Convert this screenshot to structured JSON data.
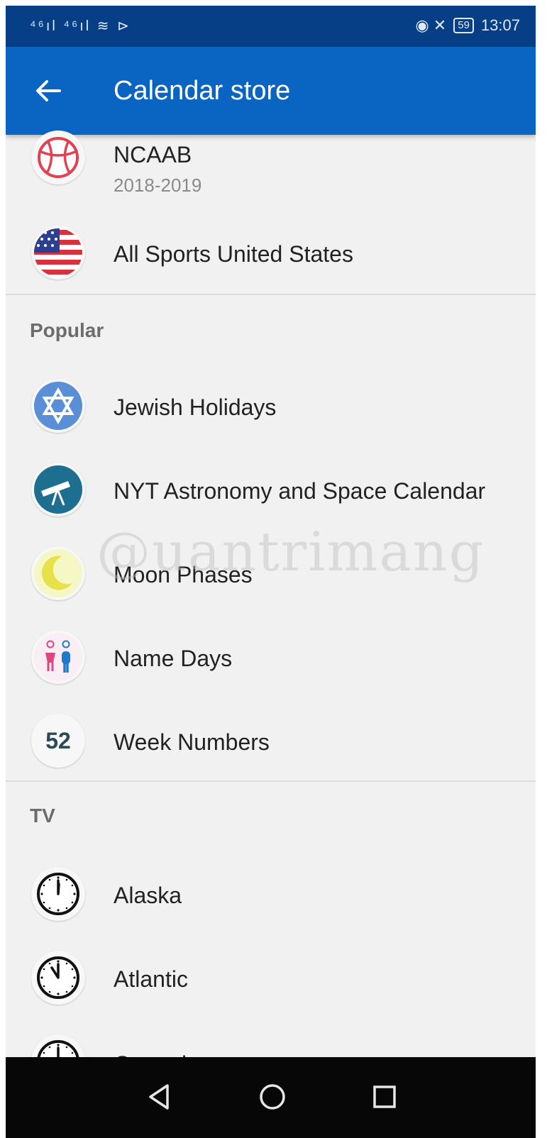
{
  "status_bar": {
    "signal_icons": "⁴⁶ıl ⁴⁶ıl ≋ ⊳",
    "right_icons": "◉ ✕",
    "battery": "59",
    "time": "13:07"
  },
  "app_bar": {
    "title": "Calendar store"
  },
  "top_items": [
    {
      "title": "NCAAB",
      "subtitle": "2018-2019",
      "icon": "basketball-icon"
    },
    {
      "title": "All Sports United States",
      "icon": "us-flag-icon"
    }
  ],
  "sections": [
    {
      "header": "Popular",
      "items": [
        {
          "title": "Jewish Holidays",
          "icon": "star-of-david-icon"
        },
        {
          "title": "NYT Astronomy and Space Calendar",
          "icon": "telescope-icon"
        },
        {
          "title": "Moon Phases",
          "icon": "crescent-moon-icon"
        },
        {
          "title": "Name Days",
          "icon": "people-icon"
        },
        {
          "title": "Week Numbers",
          "icon": "week-number-icon",
          "icon_text": "52"
        }
      ]
    },
    {
      "header": "TV",
      "items": [
        {
          "title": "Alaska",
          "icon": "clock-icon"
        },
        {
          "title": "Atlantic",
          "icon": "clock-icon"
        },
        {
          "title": "Central",
          "icon": "clock-icon"
        }
      ]
    }
  ],
  "watermark": "@uantrimang",
  "colors": {
    "status_bar": "#063f85",
    "app_bar": "#0a64c2",
    "background": "#f1f1f1"
  }
}
